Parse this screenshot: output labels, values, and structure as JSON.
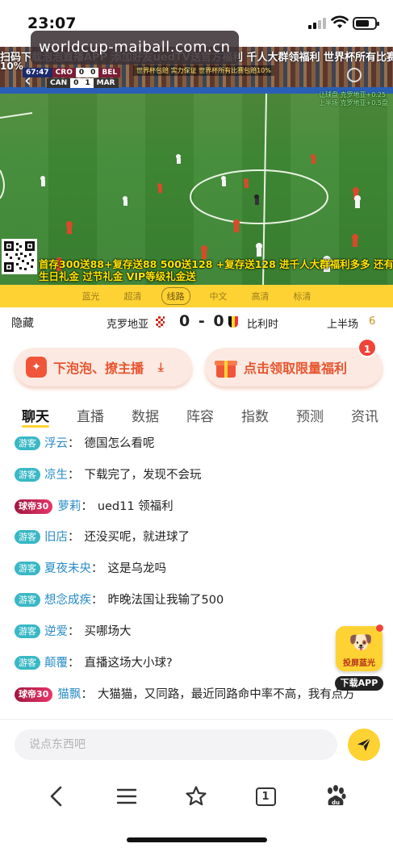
{
  "status_bar": {
    "time": "23:07"
  },
  "watermark": "worldcup-maiball.com.cn",
  "video": {
    "overlay_top_line": "扫码下载泡泡直播APP 添加好友uedTV送官方福利 千人大群领福利 世界杯所有比赛包赔",
    "overlay_top_line2": "10%",
    "scorebug": {
      "clock": "67:47",
      "home_team": "CRO",
      "home_score": "0",
      "away_team": "BEL",
      "away_score": "0",
      "row2_team_a": "CAN",
      "row2_score_a": "0",
      "row2_score_b": "1",
      "row2_team_b": "MAR"
    },
    "ad_strip": "世界杯包赔 实力保证 世界杯所有比赛包赔10%",
    "right_info": [
      "让球盘 克罗地亚+0.25",
      "上半场 克罗地亚+0.5盘"
    ],
    "promo_text": "首存300送88+复存送88 500送128 +复存送128 进千人大群福利多多 还有生日礼金 过节礼金 VIP等级礼金送",
    "quality_options": [
      "蓝光",
      "超清",
      "线路",
      "中文",
      "高清",
      "标清"
    ],
    "quality_active_index": 2
  },
  "match": {
    "hide_label": "隐藏",
    "team_a": "克罗地亚",
    "score": "0 - 0",
    "team_b": "比利时",
    "period": "上半场",
    "period_num": "6"
  },
  "actions": {
    "left_label": "下泡泡、撩主播",
    "right_label": "点击领取限量福利",
    "badge": "1"
  },
  "tabs": [
    "聊天",
    "直播",
    "数据",
    "阵容",
    "指数",
    "预测",
    "资讯"
  ],
  "chat": [
    {
      "tag": "游客",
      "vip": false,
      "user": "浮云",
      "text": "德国怎么看呢"
    },
    {
      "tag": "游客",
      "vip": false,
      "user": "凉生",
      "text": "下载完了，发现不会玩"
    },
    {
      "tag": "球帝30",
      "vip": true,
      "user": "萝莉",
      "text": "ued11 领福利"
    },
    {
      "tag": "游客",
      "vip": false,
      "user": "旧店",
      "text": "还没买呢，就进球了"
    },
    {
      "tag": "游客",
      "vip": false,
      "user": "夏夜未央",
      "text": "这是乌龙吗"
    },
    {
      "tag": "游客",
      "vip": false,
      "user": "想念成疾",
      "text": "昨晚法国让我输了500"
    },
    {
      "tag": "游客",
      "vip": false,
      "user": "逆爱",
      "text": "买哪场大"
    },
    {
      "tag": "游客",
      "vip": false,
      "user": "颠覆",
      "text": "直播这场大小球?"
    },
    {
      "tag": "球帝30",
      "vip": true,
      "user": "猫飘",
      "text": "大猫猫，又同路，最近同路命中率不高，我有点方"
    }
  ],
  "float_promo": {
    "tile_label": "投屏蓝光",
    "download_label": "下载APP"
  },
  "input": {
    "placeholder": "说点东西吧"
  },
  "toolbar": {
    "tab_count": "1"
  },
  "colors": {
    "accent": "#ffd233",
    "brand_orange": "#e8542e",
    "guest_tag": "#39b8c5",
    "username": "#2a8cc7"
  }
}
